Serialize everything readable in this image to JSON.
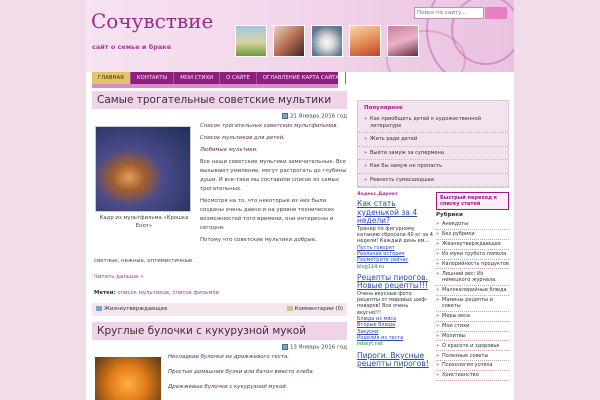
{
  "header": {
    "site_title": "Сочувствие",
    "site_desc": "сайт о семье и браке",
    "search_placeholder": "Поиск по сайту..."
  },
  "nav": {
    "items": [
      "ГЛАВНАЯ",
      "КОНТАКТЫ",
      "МОИ СТИХИ",
      "О САЙТЕ",
      "ОГЛАВЛЕНИЕ КАРТА САЙТА"
    ]
  },
  "post1": {
    "title": "Самые трогательные советские мультики",
    "date": "21 Январь 2016 год",
    "p1": "Список трогательных советских мультфильмов.",
    "p2": "Список мультиков для детей.",
    "p3": "Любимые мультики.",
    "p4": "Все наши советские мультики замечательные. Все вызывают умиление, могут растрогать до глубины души. И все-таки мы составили список из самых трогательных.",
    "p5": "Несмотря на то, что некоторые из них были созданы очень давно и на уровне технических возможностей того времени, они интересны и сегодня.",
    "p6": "Потому что советские мультики добрые,",
    "p7": "светлые, нежные, оптимистичные.",
    "caption": "Кадр из мультфильма «Крошка Енот»",
    "read_more": "Читать дальше »",
    "tags_label": "Метки:",
    "tag1": "список мультиков",
    "tag_sep": ",",
    "tag2": "список фильмов",
    "category": "Жизнеутверждающее",
    "comments": "Комментарии (0)"
  },
  "post2": {
    "title": "Круглые булочки с кукурузной мукой",
    "date": "13 Январь 2016 год",
    "p1": "Несладкие булочки из дрожжевого теста.",
    "p2": "Простые домашние булки или батон вместо хлеба.",
    "p3": "Дрожжевые булочки с кукурузной мукой."
  },
  "popular": {
    "heading": "Популярное",
    "items": [
      "Как приобщить детей к художественной литературе",
      "Жить ради детей",
      "Выйти замуж за супермена",
      "Как бы замуж не пропасть",
      "Ревность сумасшедшая"
    ]
  },
  "ads": {
    "label": "Яндекс.Директ",
    "ad1_title": "Как стать худенькой за 4 недели?",
    "ad1_text": "Тренер по фигурному катанию сбросила 40 кг за 4 недели! Каждый день ем...",
    "ad1_links": [
      "Пусть говорят",
      "Реальная история",
      "Посмотрите сейчас"
    ],
    "ad1_domain": "blog114.ru",
    "ad2_title": "Рецепты пирогов. Новые рецепты!!!",
    "ad2_text": "Очень вкусные фото рецепты от мировых шеф-поваров! Все очень вкусно!!!",
    "ad2_links": [
      "Блюда из мяса",
      "Вторые блюда",
      "Закуски",
      "Изделия из теста"
    ],
    "ad2_domain": "rebeyt.net",
    "ad3_title": "Пироги. Вкусные рецепты пирогов!"
  },
  "rubrics": {
    "fast_link": "Быстрый переход к списку статей",
    "heading": "Рубрики",
    "items": [
      "Анекдоты",
      "Без рубрики",
      "Жизнеутверждающее",
      "Из муки грубого помола",
      "Калорийность продуктов",
      "Лишний вес: Из немецкого журнала.",
      "Малокалорийные блюда",
      "Мамины рецепты и советы",
      "Меры веса",
      "Мои стихи",
      "Молитвы",
      "О красоте и здоровье",
      "Полезные советы",
      "Психология успеха",
      "Христианство"
    ]
  },
  "colors": {
    "brand": "#9a2a8e",
    "nav": "#8e1f7c",
    "nav_active": "#e0c46a",
    "page_bg": "#f1dcea"
  }
}
